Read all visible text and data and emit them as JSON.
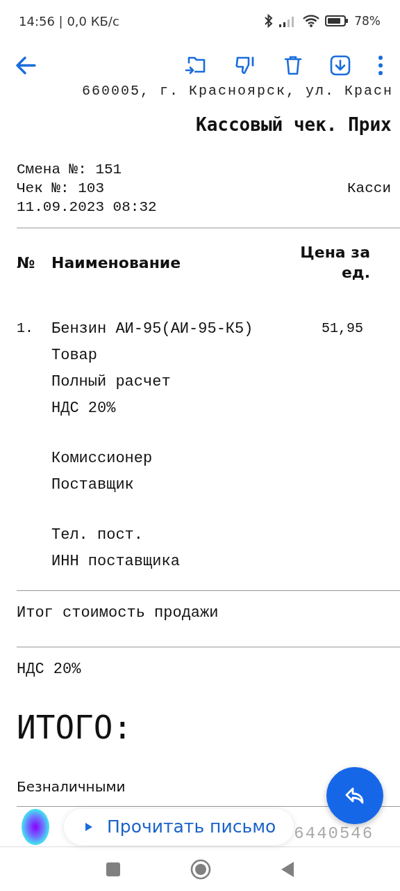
{
  "status_bar": {
    "time": "14:56 | 0,0 КБ/с",
    "battery": "78%"
  },
  "receipt": {
    "address": "660005, г. Красноярск, ул. Красн",
    "title": "Кассовый чек. Прих",
    "shift": "Смена №: 151",
    "check": "Чек №: 103",
    "cashier": "Касси",
    "datetime": "11.09.2023 08:32",
    "columns": [
      "№",
      "Наименование",
      "Цена за ед."
    ],
    "items": [
      {
        "number": "1.",
        "price": "51,95",
        "lines": [
          [
            "Бензин АИ-95(АИ-95-К5)",
            "Товар",
            "Полный расчет",
            "НДС 20%"
          ],
          [
            "Комиссионер",
            "Поставщик"
          ],
          [
            "Тел. пост.",
            "ИНН поставщика"
          ]
        ]
      }
    ],
    "total_sale": "Итог стоимость продажи",
    "vat": "НДС 20%",
    "grand_total": "ИТОГО:",
    "payment": "Безналичными",
    "footer_number": "6440546"
  },
  "read_aloud": {
    "label": "Прочитать письмо"
  }
}
